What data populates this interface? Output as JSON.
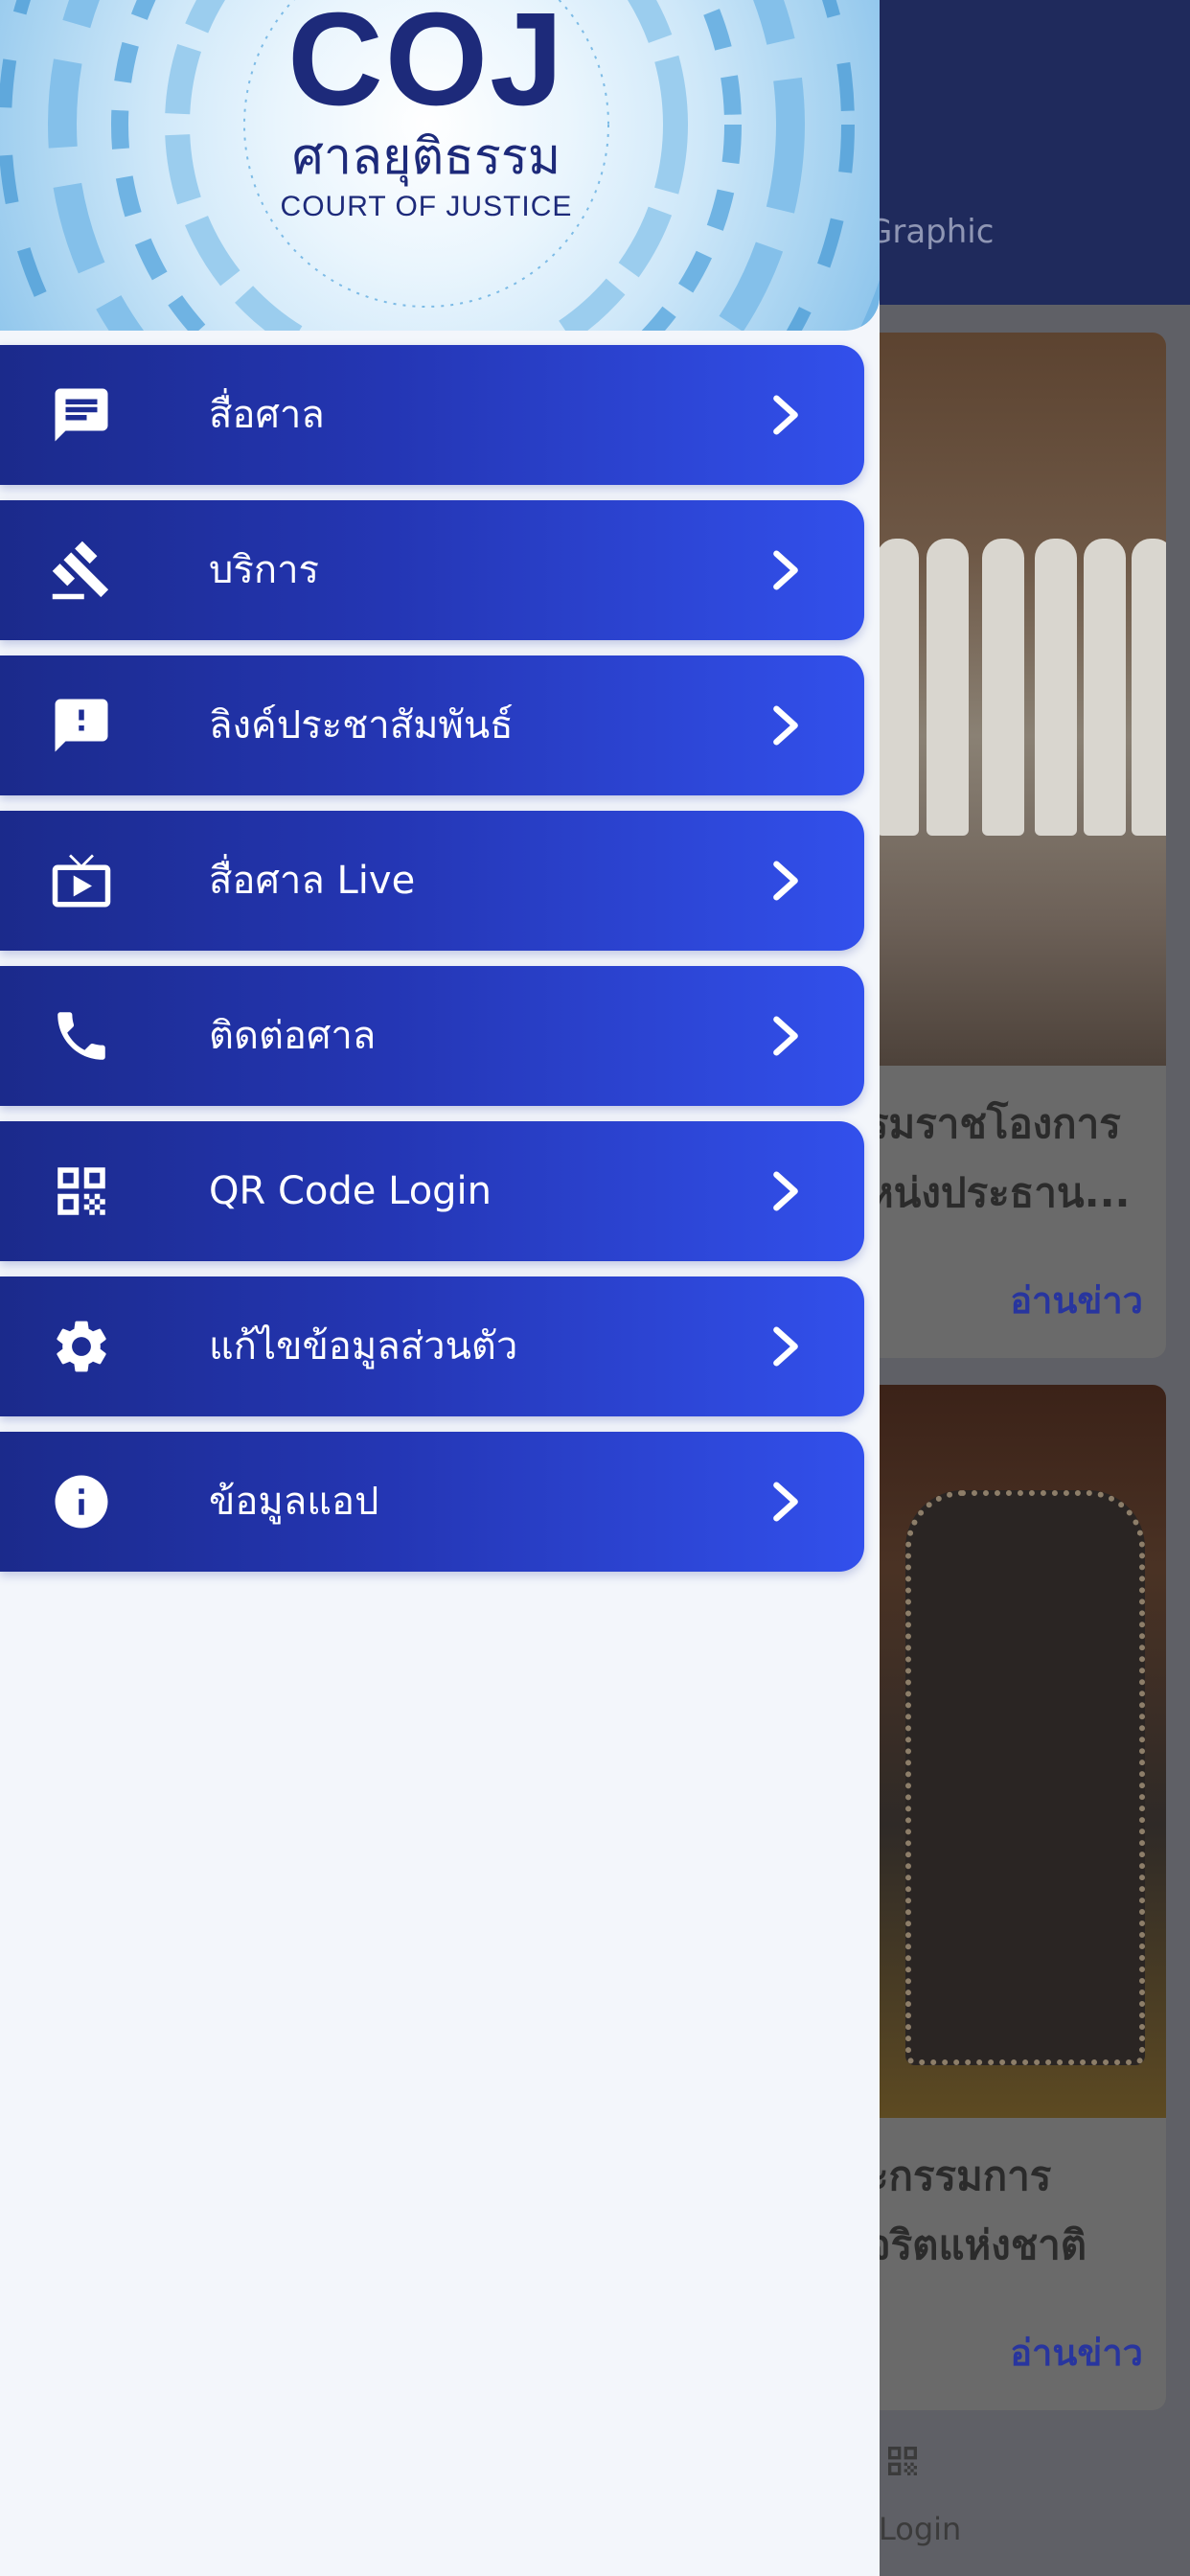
{
  "background": {
    "tab_label": "Graphic",
    "cards": [
      {
        "title_line1": "รมราชโองการ",
        "title_line2": "หน่งประธาน...",
        "read_more": "อ่านข่าว"
      },
      {
        "title_line1": "ะกรรมการ",
        "title_line2": "จริตแห่งชาติ",
        "read_more": "อ่านข่าว"
      }
    ],
    "bottom_nav_label": "Login"
  },
  "drawer": {
    "logo": {
      "abbr": "COJ",
      "thai_name": "ศาลยุติธรรม",
      "english_name": "COURT OF JUSTICE"
    },
    "menu": [
      {
        "label": "สื่อศาล",
        "icon": "message-icon"
      },
      {
        "label": "บริการ",
        "icon": "gavel-icon"
      },
      {
        "label": "ลิงค์ประชาสัมพันธ์",
        "icon": "alert-message-icon"
      },
      {
        "label": "สื่อศาล Live",
        "icon": "live-tv-icon"
      },
      {
        "label": "ติดต่อศาล",
        "icon": "phone-icon"
      },
      {
        "label": "QR Code Login",
        "icon": "qr-code-icon"
      },
      {
        "label": "แก้ไขข้อมูลส่วนตัว",
        "icon": "gear-icon"
      },
      {
        "label": "ข้อมูลแอป",
        "icon": "info-icon"
      }
    ]
  }
}
